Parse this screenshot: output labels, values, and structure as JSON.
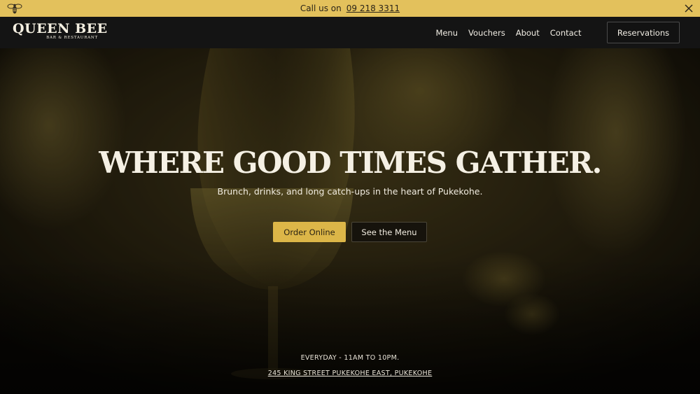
{
  "announcement": {
    "call_label": "Call us on",
    "phone": "09 218 3311",
    "icons": {
      "logo": "bee-icon",
      "close": "close-icon"
    }
  },
  "nav": {
    "logo_name": "QUEEN BEE",
    "logo_sub": "BAR & RESTAURANT",
    "links": [
      "Menu",
      "Vouchers",
      "About",
      "Contact"
    ],
    "reservations_label": "Reservations"
  },
  "hero": {
    "title": "WHERE GOOD TIMES GATHER.",
    "subtitle": "Brunch, drinks, and long catch-ups in the heart of Pukekohe.",
    "order_label": "Order Online",
    "menu_label": "See the Menu",
    "hours": "EVERYDAY - 11AM TO 10PM.",
    "address": "245 KING STREET PUKEKOHE EAST, PUKEKOHE"
  },
  "colors": {
    "announcement_bg": "#e3c15c",
    "nav_bg": "#141414",
    "accent_gold": "#dcb648",
    "text_light": "#f5f0e4"
  }
}
